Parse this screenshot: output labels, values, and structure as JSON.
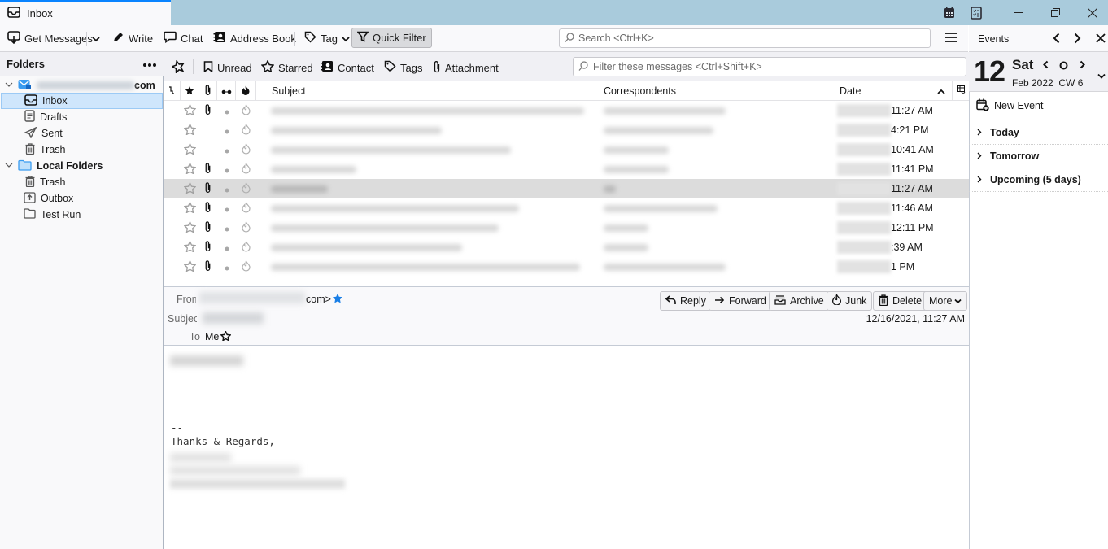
{
  "window": {
    "tab_label": "Inbox",
    "calendar_icon": "calendar-icon",
    "tasks_icon": "tasks-icon",
    "minimize_icon": "minimize-icon",
    "restore_icon": "restore-icon",
    "close_icon": "close-icon"
  },
  "toolbar": {
    "get_messages": "Get Messages",
    "write": "Write",
    "chat": "Chat",
    "address_book": "Address Book",
    "tag": "Tag",
    "quick_filter": "Quick Filter",
    "search_placeholder": "Search <Ctrl+K>"
  },
  "folders": {
    "header": "Folders",
    "account_suffix": "com",
    "account_items": [
      {
        "label": "Inbox",
        "icon": "inbox-icon",
        "selected": true
      },
      {
        "label": "Drafts",
        "icon": "drafts-icon"
      },
      {
        "label": "Sent",
        "icon": "sent-icon"
      },
      {
        "label": "Trash",
        "icon": "trash-icon"
      }
    ],
    "local_folders": "Local Folders",
    "local_items": [
      {
        "label": "Trash",
        "icon": "trash-icon"
      },
      {
        "label": "Outbox",
        "icon": "outbox-icon"
      },
      {
        "label": "Test Run",
        "icon": "folder-icon"
      }
    ]
  },
  "quick_filter": {
    "unread": "Unread",
    "starred": "Starred",
    "contact": "Contact",
    "tags": "Tags",
    "attachment": "Attachment",
    "filter_placeholder": "Filter these messages <Ctrl+Shift+K>"
  },
  "thread_columns": {
    "subject": "Subject",
    "correspondents": "Correspondents",
    "date": "Date"
  },
  "messages": [
    {
      "attachment": true,
      "time": "11:27 AM",
      "selected": false
    },
    {
      "attachment": false,
      "time": "4:21 PM",
      "selected": false
    },
    {
      "attachment": false,
      "time": "10:41 AM",
      "selected": false
    },
    {
      "attachment": true,
      "time": "11:41 PM",
      "selected": false
    },
    {
      "attachment": true,
      "time": "11:27 AM",
      "selected": true
    },
    {
      "attachment": true,
      "time": "11:46 AM",
      "selected": false
    },
    {
      "attachment": true,
      "time": "12:11 PM",
      "selected": false
    },
    {
      "attachment": true,
      "time": ":39 AM",
      "selected": false
    },
    {
      "attachment": true,
      "time": "1 PM",
      "selected": false
    }
  ],
  "message_header": {
    "from_label": "From",
    "from_suffix": "com>",
    "subject_label": "Subject",
    "to_label": "To",
    "to_value": "Me",
    "date": "12/16/2021, 11:27 AM",
    "buttons": {
      "reply": "Reply",
      "forward": "Forward",
      "archive": "Archive",
      "junk": "Junk",
      "delete": "Delete",
      "more": "More"
    }
  },
  "message_body": {
    "sig_separator": "--",
    "closing": "Thanks & Regards,"
  },
  "events": {
    "title": "Events",
    "day_number": "12",
    "weekday": "Sat",
    "month_year_week": "Feb 2022  CW 6",
    "new_event": "New Event",
    "sections": [
      "Today",
      "Tomorrow",
      "Upcoming (5 days)"
    ]
  },
  "colors": {
    "accent": "#0a84ff",
    "titlebar": "#a9cbdc",
    "selected_folder": "#cfe6fc",
    "selected_row": "#dcdcdc",
    "star_blue": "#1a7fe6"
  }
}
